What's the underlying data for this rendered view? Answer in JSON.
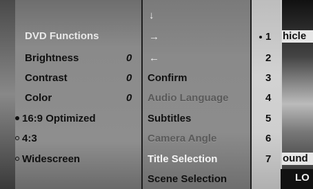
{
  "left_menu": {
    "header": "DVD Functions",
    "items": [
      {
        "label": "Brightness",
        "value": "0"
      },
      {
        "label": "Contrast",
        "value": "0"
      },
      {
        "label": "Color",
        "value": "0"
      }
    ],
    "aspect": [
      {
        "label": "16:9 Optimized",
        "selected": true
      },
      {
        "label": "4:3",
        "selected": false
      },
      {
        "label": "Widescreen",
        "selected": false
      }
    ]
  },
  "middle_menu": {
    "arrows": [
      "↓",
      "→",
      "←"
    ],
    "items": [
      {
        "label": "Confirm"
      },
      {
        "label": "Audio Language"
      },
      {
        "label": "Subtitles"
      },
      {
        "label": "Camera Angle"
      },
      {
        "label": "Title Selection"
      },
      {
        "label": "Scene Selection"
      }
    ]
  },
  "numbers": [
    "1",
    "2",
    "3",
    "4",
    "5",
    "6",
    "7"
  ],
  "side": {
    "top_text": "hicle",
    "bottom_text": "ound",
    "corner_text": "LO"
  }
}
